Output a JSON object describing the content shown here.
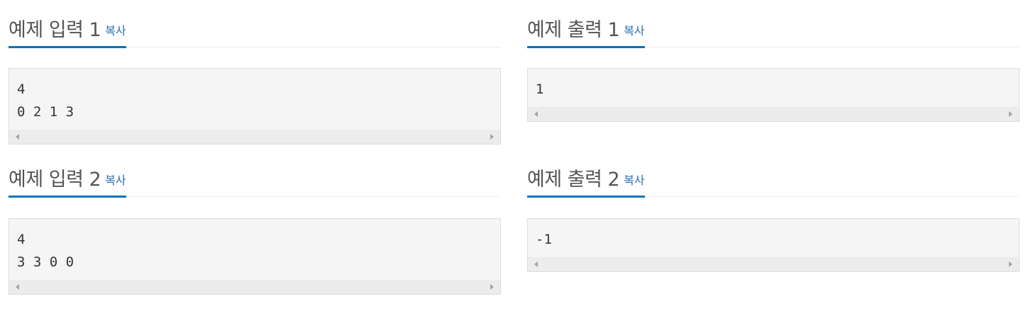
{
  "sections": {
    "input1": {
      "title": "예제 입력 1",
      "copy": "복사",
      "content": "4\n0 2 1 3"
    },
    "output1": {
      "title": "예제 출력 1",
      "copy": "복사",
      "content": "1"
    },
    "input2": {
      "title": "예제 입력 2",
      "copy": "복사",
      "content": "4\n3 3 0 0"
    },
    "output2": {
      "title": "예제 출력 2",
      "copy": "복사",
      "content": "-1"
    }
  },
  "colors": {
    "accent_underline": "#0b72b5",
    "copy_link": "#2a6fb0",
    "box_background": "#f5f5f6"
  },
  "icons": [
    "scroll-left-arrow-icon",
    "scroll-right-arrow-icon"
  ]
}
